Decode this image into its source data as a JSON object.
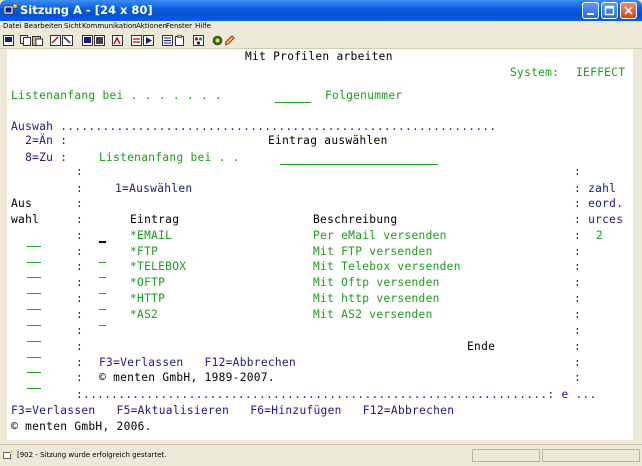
{
  "window": {
    "title": "Sitzung A - [24 x 80]",
    "title_bar_color": "#0a5fe0",
    "icon": "session-app-icon"
  },
  "menubar": {
    "items": [
      "Datei",
      "Bearbeiten",
      "Sicht",
      "Kommunikation",
      "Aktionen",
      "Fenster",
      "Hilfe"
    ]
  },
  "toolbar": {
    "icons": [
      "print-screen-icon",
      "copy-icon",
      "paste-icon",
      "send-icon",
      "receive-icon",
      "display-icon",
      "settings-icon",
      "record-macro-icon",
      "stop-macro-icon",
      "play-macro-icon",
      "macro-list-icon",
      "clipboard-icon",
      "color-palette-icon",
      "pen-icon"
    ]
  },
  "terminal": {
    "colors": {
      "blue": "#1a1a8c",
      "green": "#18a018",
      "background": "#ffffff"
    },
    "screen_title": "Mit Profilen arbeiten",
    "system_label": "System:",
    "system_value": "IEFFECT",
    "list_start_label": "Listenanfang bei . . . . . . .",
    "list_start_suffix": "Folgenummer",
    "auswah_line": "Auswah ..............................................................",
    "option_2": "  2=Än :",
    "option_8": "  8=Zu :",
    "popup": {
      "title": "Eintrag auswählen",
      "list_start_label": "Listenanfang bei . .",
      "option_hint": "1=Auswählen",
      "col_entry": "Eintrag",
      "col_desc": "Beschreibung",
      "rows": [
        {
          "entry": "*EMAIL",
          "desc": "Per eMail versenden"
        },
        {
          "entry": "*FTP",
          "desc": "Mit FTP versenden"
        },
        {
          "entry": "*TELEBOX",
          "desc": "Mit Telebox versenden"
        },
        {
          "entry": "*OFTP",
          "desc": "Mit Oftp versenden"
        },
        {
          "entry": "*HTTP",
          "desc": "Mit http versenden"
        },
        {
          "entry": "*AS2",
          "desc": "Mit AS2 versenden"
        }
      ],
      "end_label": "Ende",
      "fkeys": "F3=Verlassen   F12=Abbrechen",
      "copyright": "© menten GmbH, 1989-2007.",
      "bottom_border": ":..................................................................: e ..."
    },
    "left_col": {
      "aus": "Aus",
      "wahl": "wahl"
    },
    "right_col": {
      "zahl": ": zahl",
      "eord": ": eord.",
      "urces": ": urces",
      "value": "2"
    },
    "fkeys": "F3=Verlassen   F5=Aktualisieren   F6=Hinzufügen   F12=Abbrechen",
    "copyright": "© menten GmbH, 2006."
  },
  "status": {
    "icon": "session-status-icon",
    "text": "[902 - Sitzung wurde erfolgreich gestartet."
  }
}
